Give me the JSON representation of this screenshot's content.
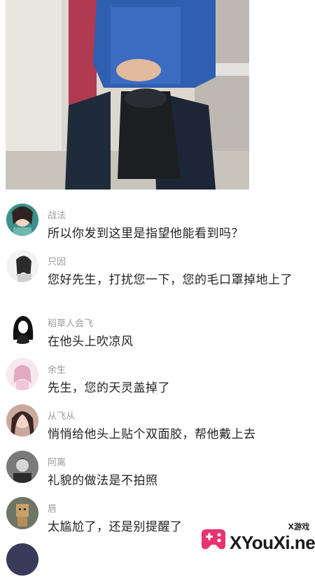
{
  "comments": [
    {
      "name": "战法",
      "text": "所以你发到这里是指望他能看到吗？"
    },
    {
      "name": "只因",
      "text": "您好先生，打扰您一下，您的毛口罩掉地上了"
    },
    {
      "name": "稻草人会飞",
      "text": "在他头上吹凉风"
    },
    {
      "name": "余生",
      "text": "先生，您的天灵盖掉了"
    },
    {
      "name": "从飞从",
      "text": "悄悄给他头上贴个双面胶，帮他戴上去"
    },
    {
      "name": "阿离",
      "text": "礼貌的做法是不拍照"
    },
    {
      "name": "唇",
      "text": "太尴尬了，还是别提醒了"
    }
  ],
  "watermark": {
    "small": "X游戏",
    "big": "XYouXi.net"
  },
  "colors": {
    "name_gray": "#9a9a9a",
    "text": "#222222",
    "logo_pink": "#e8336f"
  }
}
